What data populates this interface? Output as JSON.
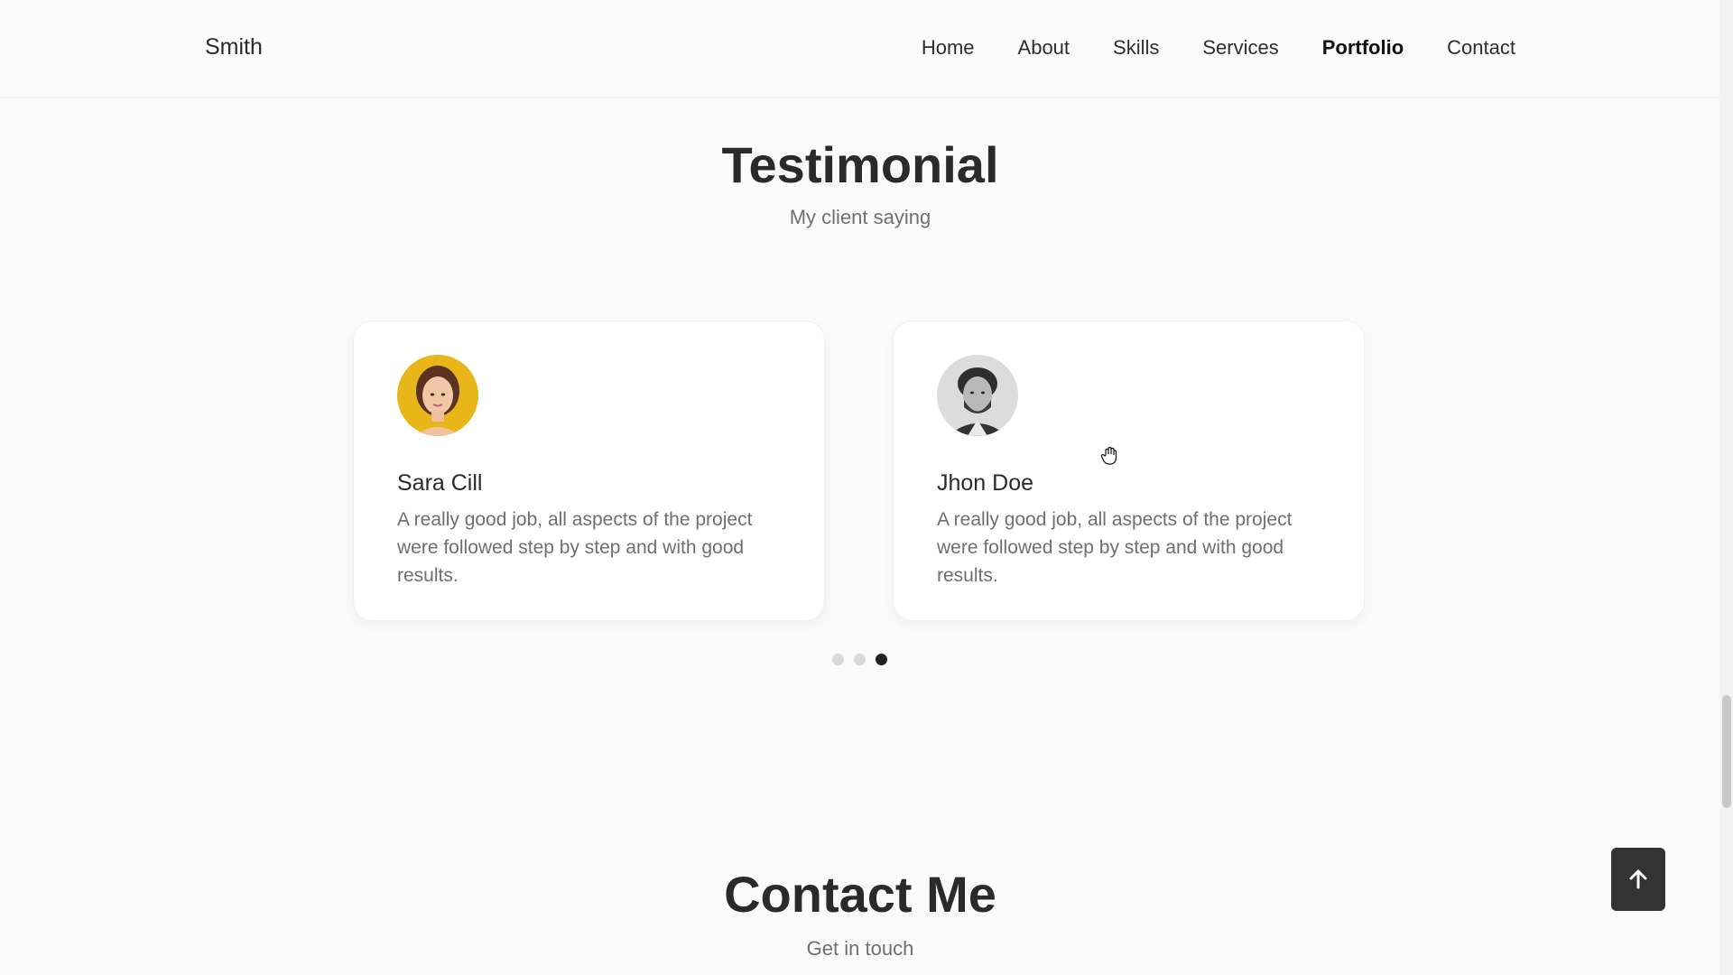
{
  "header": {
    "logo": "Smith",
    "nav": [
      {
        "label": "Home"
      },
      {
        "label": "About"
      },
      {
        "label": "Skills"
      },
      {
        "label": "Services"
      },
      {
        "label": "Portfolio",
        "active": true
      },
      {
        "label": "Contact"
      }
    ]
  },
  "testimonial": {
    "title": "Testimonial",
    "subtitle": "My client saying",
    "cards": [
      {
        "name": "Sara Cill",
        "quote": "A really good job, all aspects of the project were followed step by step and with good results.",
        "avatar_bg": "#e8b619"
      },
      {
        "name": "Jhon Doe",
        "quote": "A really good job, all aspects of the project were followed step by step and with good results.",
        "avatar_bg": "#d8d8d8"
      }
    ],
    "pagination": {
      "count": 3,
      "active_index": 2
    }
  },
  "contact": {
    "title": "Contact Me",
    "subtitle": "Get in touch"
  },
  "scroll_up": {
    "icon": "arrow-up-icon"
  },
  "colors": {
    "background": "#fafafa",
    "text_dark": "#2a2a2a",
    "text_muted": "#707070",
    "button_dark": "#333333"
  }
}
